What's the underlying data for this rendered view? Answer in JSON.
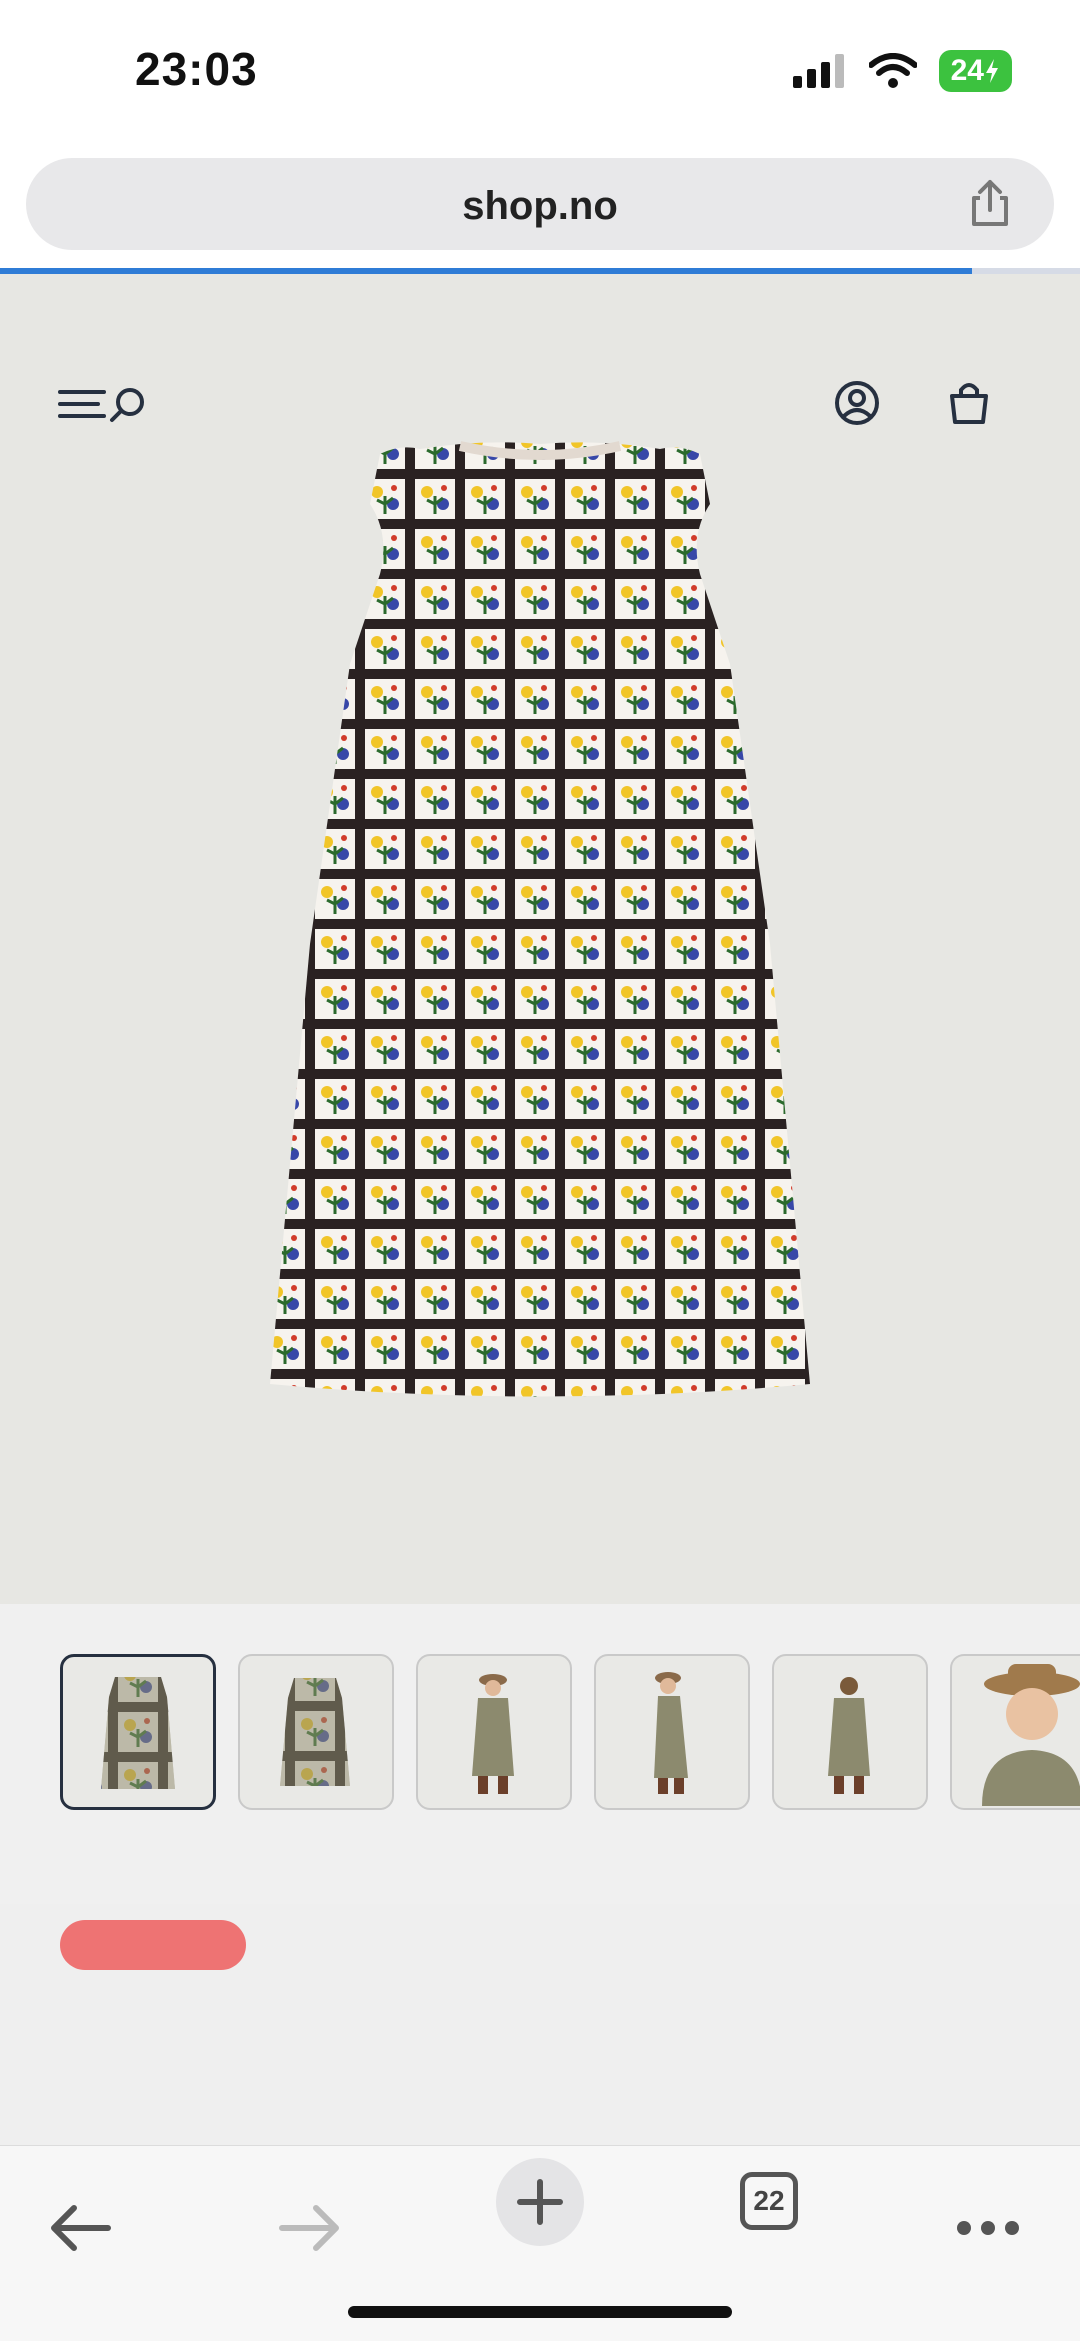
{
  "status_bar": {
    "time": "23:03",
    "battery": "24"
  },
  "browser": {
    "url": "shop.no",
    "load_progress": 0.9,
    "tab_count": "22"
  },
  "colors": {
    "accent_progress": "#2f7cd6",
    "battery": "#3cc23f",
    "pill": "#ee7373",
    "header_icons": "#263040"
  },
  "header": {
    "icons": [
      "menu-icon",
      "search-icon",
      "account-icon",
      "cart-icon"
    ]
  },
  "product": {
    "main_image": "floral-grid-print-sleeveless-dress",
    "thumbnails": [
      "dress-front",
      "dress-back",
      "model-front",
      "model-side",
      "model-back",
      "model-closeup"
    ],
    "selected_thumbnail": 0
  },
  "toolbar": {
    "buttons": [
      "back-icon",
      "forward-icon",
      "new-tab-icon",
      "tabs-icon",
      "more-icon"
    ]
  }
}
